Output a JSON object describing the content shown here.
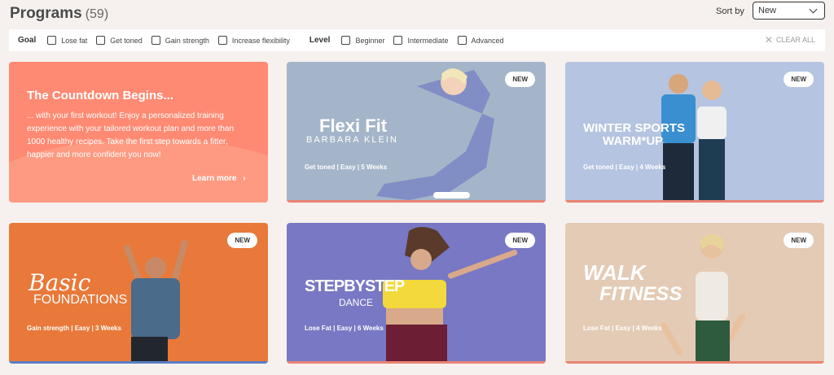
{
  "header": {
    "title": "Programs",
    "count": "(59)",
    "sort_label": "Sort by",
    "sort_value": "New"
  },
  "filters": {
    "goal_label": "Goal",
    "goals": [
      "Lose fat",
      "Get toned",
      "Gain strength",
      "Increase flexibility"
    ],
    "level_label": "Level",
    "levels": [
      "Beginner",
      "Intermediate",
      "Advanced"
    ],
    "clear_all": "CLEAR ALL"
  },
  "promo": {
    "title": "The Countdown Begins...",
    "text": "... with your first workout! Enjoy a personalized training experience with your tailored workout plan and more than 1000 healthy recipes. Take the first step towards a fitter, happier and more confident you now!",
    "cta": "Learn more"
  },
  "cards": [
    {
      "brand1": "Flexi Fit",
      "brand2": "BARBARA KLEIN",
      "badge": "NEW",
      "meta": "Get toned  |  Easy  |  5 Weeks"
    },
    {
      "brand1": "WINTER SPORTS",
      "brand2": "WARM*UP",
      "badge": "NEW",
      "meta": "Get toned  |  Easy  |  4 Weeks"
    },
    {
      "brand1": "Basic",
      "brand2": "FOUNDATIONS",
      "badge": "NEW",
      "meta": "Gain strength  |  Easy  |  3 Weeks"
    },
    {
      "brand1": "STEPBYSTEP",
      "brand2": "DANCE",
      "badge": "NEW",
      "meta": "Lose Fat  |  Easy  |  6 Weeks"
    },
    {
      "brand1": "WALK",
      "brand2": "FITNESS",
      "badge": "NEW",
      "meta": "Lose Fat  |  Easy  |  4 Weeks"
    }
  ],
  "icons": {
    "sort_chevron": "chevron-down-icon",
    "clear": "close-icon",
    "cta_arrow": "chevron-right-icon"
  }
}
